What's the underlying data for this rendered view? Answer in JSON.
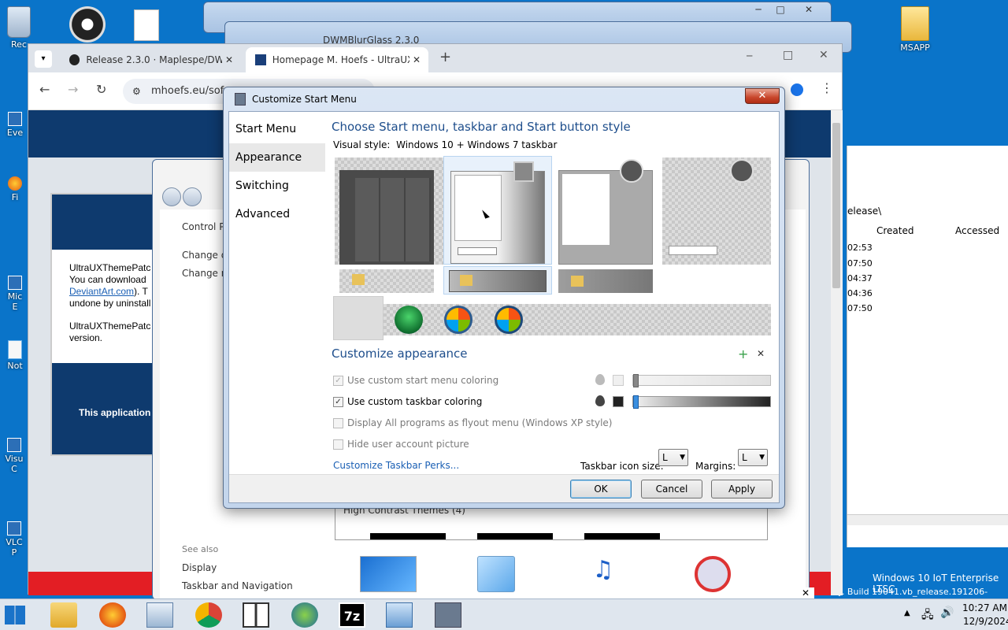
{
  "desktop": {
    "icons_left": [
      {
        "label": "Rec",
        "icon": "recycle-bin-icon"
      },
      {
        "label": "Eve",
        "icon": "event-viewer-icon"
      },
      {
        "label": "Fi",
        "icon": "firefox-icon"
      },
      {
        "label": "Mic E",
        "icon": "edge-icon"
      },
      {
        "label": "Not",
        "icon": "notepad-icon"
      },
      {
        "label": "Visu C",
        "icon": "visual-studio-icon"
      },
      {
        "label": "VLC P",
        "icon": "vlc-icon"
      }
    ],
    "icon_right": {
      "label": "MSAPP",
      "icon": "folder-icon"
    },
    "os_label_line1": "Windows 10 IoT Enterprise LTSC",
    "os_label_line2": "y. Build 19041.vb_release.191206-1406"
  },
  "browser": {
    "tabs": [
      {
        "label": "Release 2.3.0 · Maplespe/DWM",
        "icon": "github-icon"
      },
      {
        "label": "Homepage M. Hoefs - UltraUXT",
        "icon": "mh-logo-icon"
      }
    ],
    "new_tab": "+",
    "url": "mhoefs.eu/sof",
    "page_text_1": "UltraUXThemePatc",
    "page_text_2": "You can download",
    "page_link": "DeviantArt.com",
    "page_text_3": "). T",
    "page_text_4": "undone by uninstall",
    "page_text_5": "UltraUXThemePatc",
    "page_text_6": "version.",
    "page_text_7": "This application n"
  },
  "bg_window_title": "DWMBlurGlass 2.3.0",
  "control_panel": {
    "link1": "Control P",
    "link2": "Change d",
    "link3": "Change n",
    "see_also": "See also",
    "display": "Display",
    "taskbar_nav": "Taskbar and Navigation",
    "list_item": "High Contrast Themes (4)"
  },
  "explorer": {
    "path": "elease\\",
    "col_created": "Created",
    "col_accessed": "Accessed",
    "rows": [
      "02:53",
      "07:50",
      "04:37",
      "04:36",
      "07:50"
    ]
  },
  "dialog": {
    "title": "Customize Start Menu",
    "close": "✕",
    "nav": [
      "Start Menu",
      "Appearance",
      "Switching",
      "Advanced"
    ],
    "heading": "Choose Start menu, taskbar and Start button style",
    "visual_style_label": "Visual style:",
    "visual_style_value": "Windows 10 + Windows 7 taskbar",
    "customize_heading": "Customize appearance",
    "plus": "+",
    "x": "✕",
    "options": [
      {
        "label": "Use custom start menu coloring",
        "checked": true,
        "enabled": false
      },
      {
        "label": "Use custom taskbar coloring",
        "checked": true,
        "enabled": true
      },
      {
        "label": "Display All programs as flyout menu (Windows XP style)",
        "checked": false,
        "enabled": false
      },
      {
        "label": "Hide user account picture",
        "checked": false,
        "enabled": false
      }
    ],
    "perks_link": "Customize Taskbar Perks...",
    "icon_size_label": "Taskbar icon size:",
    "icon_size_value": "L",
    "margins_label": "Margins:",
    "margins_value": "L",
    "ok": "OK",
    "cancel": "Cancel",
    "apply": "Apply"
  },
  "taskbar": {
    "time": "10:27 AM",
    "date": "12/9/2024"
  },
  "colors": {
    "desktop": "#0a74c9",
    "accent_blue": "#1e4e8c",
    "link": "#1a5fb4"
  }
}
